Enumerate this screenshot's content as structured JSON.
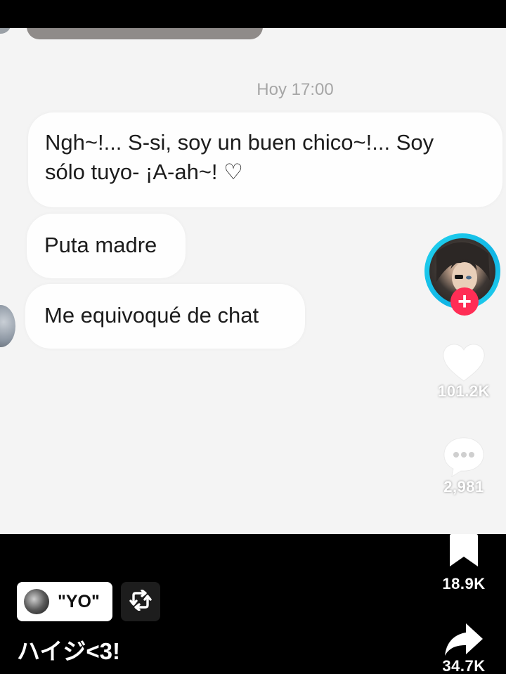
{
  "chat": {
    "timestamp": "Hoy 17:00",
    "messages": [
      {
        "line1": "Ngh~!... S-si, soy un buen chico~!... Soy",
        "line2": "sólo tuyo- ¡A-ah~! ♡"
      },
      {
        "text": "Puta madre"
      },
      {
        "text": "Me equivoqué de chat"
      }
    ]
  },
  "actions": {
    "follow_symbol": "+",
    "likes": "101.2K",
    "comments": "2,981",
    "saves": "18.9K",
    "shares": "34.7K"
  },
  "post": {
    "sound_label": "\"YO\"",
    "caption": "ハイジ<3!"
  },
  "colors": {
    "accent_follow": "#ff2d55",
    "avatar_ring": "#22d3ee",
    "video_background": "#f4f4f4"
  },
  "icons": {
    "like": "heart-icon",
    "comment": "comment-bubble-icon",
    "save": "bookmark-icon",
    "share": "share-arrow-icon",
    "repost": "repost-icon"
  }
}
